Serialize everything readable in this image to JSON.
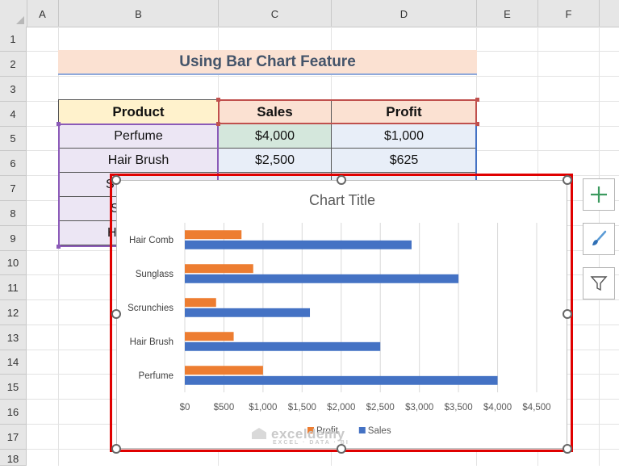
{
  "columns": [
    "A",
    "B",
    "C",
    "D",
    "E",
    "F"
  ],
  "rows": [
    "1",
    "2",
    "3",
    "4",
    "5",
    "6",
    "7",
    "8",
    "9",
    "10",
    "11",
    "12",
    "13",
    "14",
    "15",
    "16",
    "17",
    "18"
  ],
  "sheet": {
    "title": "Using Bar Chart Feature",
    "headers": [
      "Product",
      "Sales",
      "Profit"
    ],
    "table": [
      {
        "product": "Perfume",
        "sales": "$4,000",
        "profit": "$1,000"
      },
      {
        "product": "Hair Brush",
        "sales": "$2,500",
        "profit": "$625"
      }
    ],
    "hidden_fragments": [
      "S",
      "S",
      "H"
    ]
  },
  "chart_data": {
    "type": "bar",
    "orientation": "horizontal",
    "title": "Chart Title",
    "categories": [
      "Perfume",
      "Hair Brush",
      "Scrunchies",
      "Sunglass",
      "Hair Comb"
    ],
    "series": [
      {
        "name": "Profit",
        "values": [
          1000,
          625,
          400,
          875,
          725
        ],
        "color": "#ed7d31"
      },
      {
        "name": "Sales",
        "values": [
          4000,
          2500,
          1600,
          3500,
          2900
        ],
        "color": "#4472c4"
      }
    ],
    "x_ticks": [
      "$0",
      "$500",
      "$1,000",
      "$1,500",
      "$2,000",
      "$2,500",
      "$3,000",
      "$3,500",
      "$4,000",
      "$4,500"
    ],
    "xlim": [
      0,
      4500
    ],
    "grid": true,
    "legend_position": "bottom"
  },
  "chart_tools": {
    "elements_icon": "plus-icon",
    "styles_icon": "brush-icon",
    "filter_icon": "filter-icon"
  },
  "watermark": {
    "name": "exceldemy",
    "tagline": "EXCEL · DATA · BI"
  },
  "colors": {
    "accent_red": "#e00000",
    "profit": "#ed7d31",
    "sales": "#4472c4"
  }
}
